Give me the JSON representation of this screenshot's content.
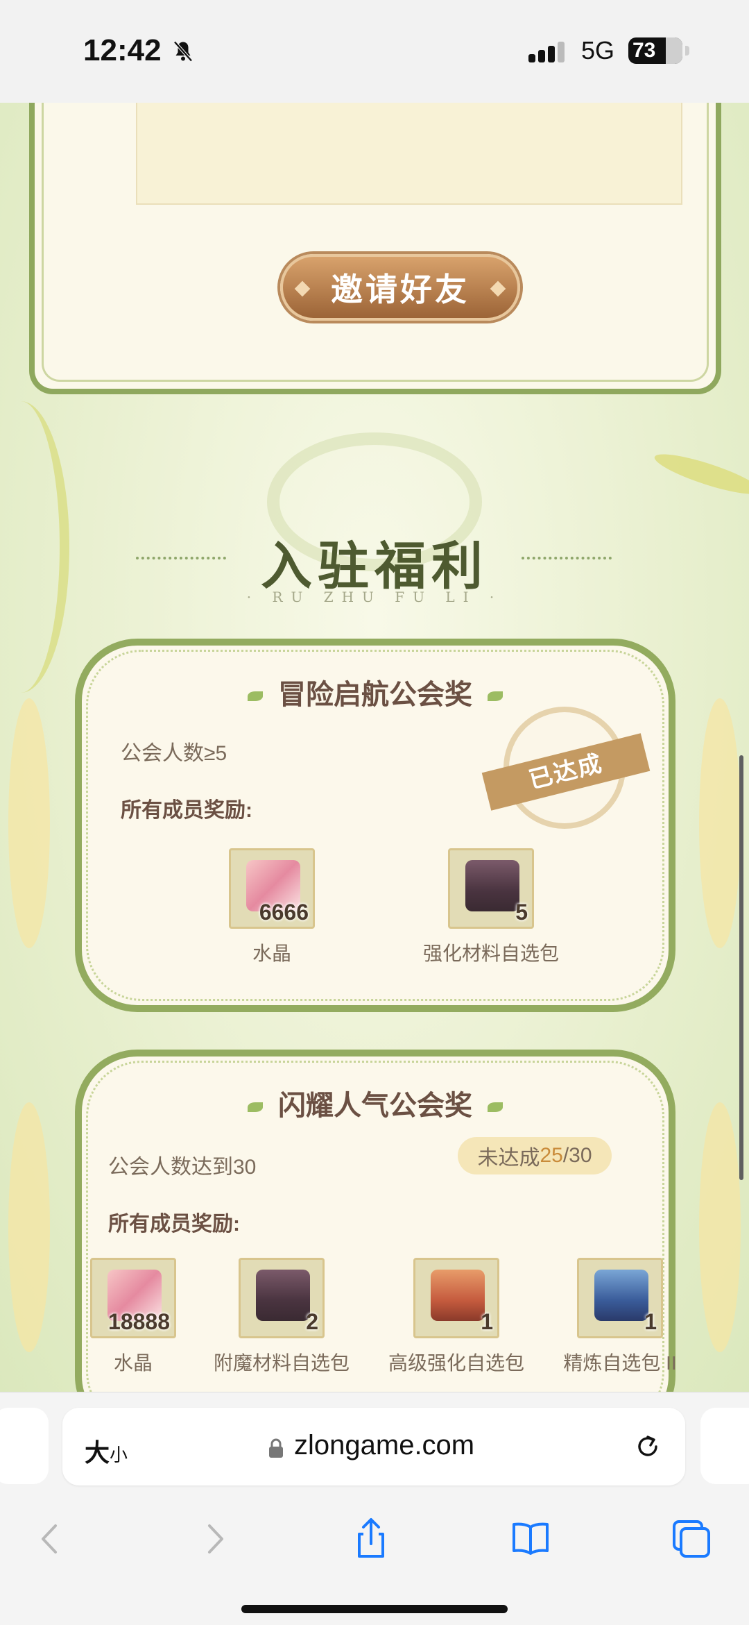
{
  "status_bar": {
    "time": "12:42",
    "network": "5G",
    "battery": "73"
  },
  "page": {
    "invite_button": "邀请好友",
    "section_title": "入驻福利",
    "section_subtitle": "· RU ZHU FU LI ·",
    "card1": {
      "title": "冒险启航公会奖",
      "condition": "公会人数≥5",
      "rewards_label": "所有成员奖励:",
      "stamp": "已达成",
      "items": [
        {
          "name": "水晶",
          "qty": "6666",
          "icon": "crystal-icon"
        },
        {
          "name": "强化材料自选包",
          "qty": "5",
          "icon": "chest-icon"
        }
      ]
    },
    "card2": {
      "title": "闪耀人气公会奖",
      "condition": "公会人数达到30",
      "status_prefix": "未达成",
      "progress_current": "25",
      "progress_total": "/30",
      "rewards_label": "所有成员奖励:",
      "items": [
        {
          "name": "水晶",
          "qty": "18888",
          "icon": "crystal-icon"
        },
        {
          "name": "附魔材料自选包",
          "qty": "2",
          "icon": "chest-icon"
        },
        {
          "name": "高级强化自选包",
          "qty": "1",
          "icon": "chest-icon"
        },
        {
          "name": "精炼自选包 II",
          "qty": "1",
          "icon": "chest-icon"
        }
      ]
    }
  },
  "browser": {
    "text_size_big": "大",
    "text_size_small": "小",
    "domain": "zlongame.com"
  },
  "colors": {
    "accent_green": "#93ab5f",
    "title_brown": "#6b5043",
    "button_brown": "#b07a4a"
  }
}
